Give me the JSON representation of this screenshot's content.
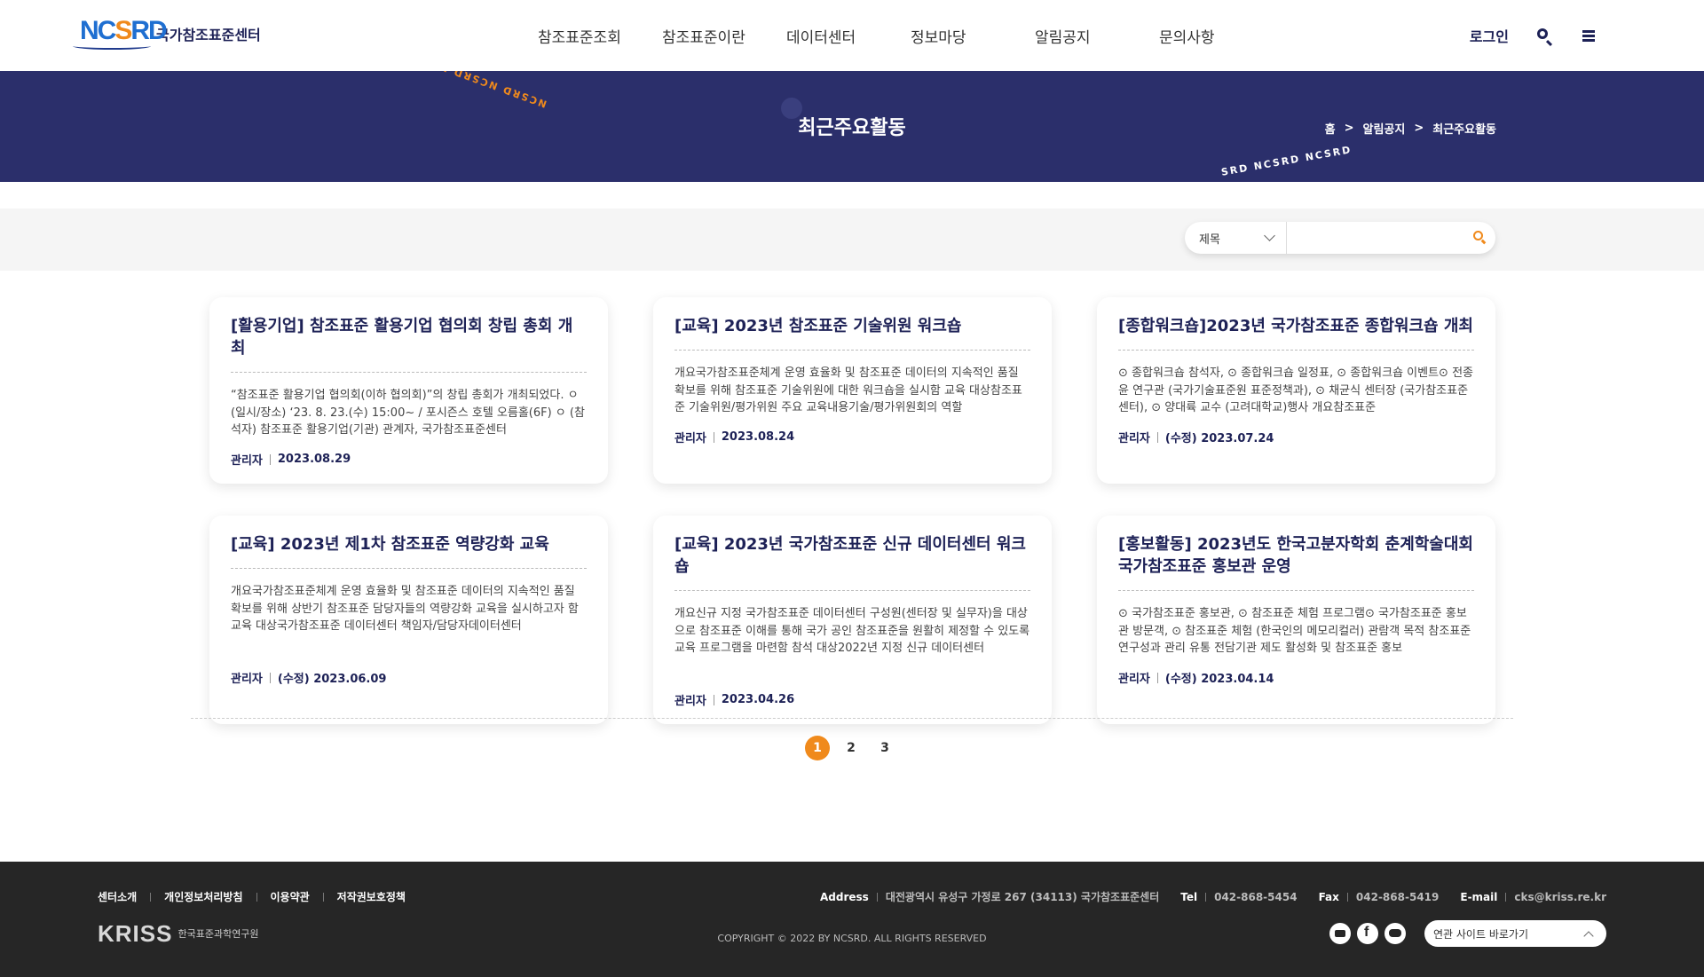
{
  "header": {
    "logo_mark": "NCSRD",
    "logo_text": "국가참조표준센터",
    "nav": [
      "참조표준조회",
      "참조표준이란",
      "데이터센터",
      "정보마당",
      "알림공지",
      "문의사항"
    ],
    "login_label": "로그인",
    "search_icon": "search-icon",
    "menu_icon": "hamburger-menu-icon"
  },
  "banner": {
    "title": "최근주요활동",
    "ring_text_a": "NCSRD NCSRD NCSRD",
    "ring_text_b": "SRD NCSRD NCSRD",
    "breadcrumb": [
      "홈",
      "알림공지",
      "최근주요활동"
    ]
  },
  "search": {
    "field_selected": "제목",
    "input_value": "",
    "placeholder": ""
  },
  "cards": [
    {
      "title": "[활용기업] 참조표준 활용기업 협의회 창립 총회 개최",
      "body": "“참조표준 활용기업 협의회(이하 협의회)”의 창립 총회가 개최되었다.  ㅇ (일시/장소) ‘23. 8. 23.(수) 15:00~ / 포시즌스 호텔 오름홀(6F) ㅇ (참석자) 참조표준 활용기업(기관) 관계자, 국가참조표준센터",
      "author": "관리자",
      "date": "2023.08.29"
    },
    {
      "title": "[교육] 2023년 참조표준 기술위원 워크숍",
      "body": " 개요국가참조표준체계 운영 효율화 및 참조표준 데이터의 지속적인 품질 확보를 위해 참조표준 기술위원에 대한 워크숍을 실시함 교육 대상참조표준 기술위원/평가위원 주요 교육내용기술/평가위원회의 역할",
      "author": "관리자",
      "date": "2023.08.24"
    },
    {
      "title": "[종합워크숍]2023년 국가참조표준 종합워크숍 개최",
      "body": "  ⊙ 종합워크숍 참석자, ⊙ 종합워크숍 일정표, ⊙ 종합워크숍 이벤트⊙ 전종윤 연구관 (국가기술표준원 표준정책과), ⊙ 채균식 센터장 (국가참조표준센터), ⊙ 양대륙 교수 (고려대학교)행사 개요참조표준",
      "author": "관리자",
      "date": "(수정) 2023.07.24"
    },
    {
      "title": "[교육] 2023년 제1차 참조표준 역량강화 교육",
      "body": " 개요국가참조표준체계 운영 효율화 및 참조표준 데이터의 지속적인 품질 확보를 위해 상반기 참조표준 담당자들의 역량강화 교육을 실시하고자 함 교육 대상국가참조표준 데이터센터 책임자/담당자데이터센터",
      "author": "관리자",
      "date": "(수정) 2023.06.09"
    },
    {
      "title": "[교육] 2023년 국가참조표준 신규 데이터센터 워크숍",
      "body": " 개요신규 지정 국가참조표준 데이터센터 구성원(센터장 및 실무자)을 대상으로 참조표준 이해를 통해 국가 공인 참조표준을 원활히 제정할 수 있도록 교육 프로그램을 마련함 참석 대상2022년 지정 신규 데이터센터",
      "author": "관리자",
      "date": "2023.04.26"
    },
    {
      "title": "[홍보활동] 2023년도 한국고분자학회 춘계학술대회 국가참조표준 홍보관 운영",
      "body": "⊙ 국가참조표준 홍보관, ⊙ 참조표준 체험 프로그램⊙ 국가참조표준 홍보관 방문객, ⊙ 참조표준 체험 (한국인의 메모리컬러) 관람객 목적 참조표준 연구성과 관리 유통 전담기관 제도 활성화 및 참조표준 홍보",
      "author": "관리자",
      "date": "(수정) 2023.04.14"
    }
  ],
  "pagination": {
    "pages": [
      "1",
      "2",
      "3"
    ],
    "current": "1"
  },
  "footer": {
    "links": [
      "센터소개",
      "개인정보처리방침",
      "이용약관",
      "저작권보호정책"
    ],
    "address_label": "Address",
    "address": "대전광역시 유성구 가정로 267 (34113) 국가참조표준센터",
    "tel_label": "Tel",
    "tel": "042-868-5454",
    "fax_label": "Fax",
    "fax": "042-868-5419",
    "email_label": "E-mail",
    "email": "cks@kriss.re.kr",
    "kriss_mark": "KRISS",
    "kriss_text": "한국표준과학연구원",
    "copyright": "COPYRIGHT © 2022 BY NCSRD. ALL RIGHTS RESERVED",
    "sns": [
      "youtube-icon",
      "facebook-icon",
      "blog-icon"
    ],
    "related_sites": "연관 사이트 바로가기"
  },
  "colors": {
    "brand_navy": "#2b2f6b",
    "accent_orange": "#f08a1c",
    "footer_bg": "#262626"
  }
}
